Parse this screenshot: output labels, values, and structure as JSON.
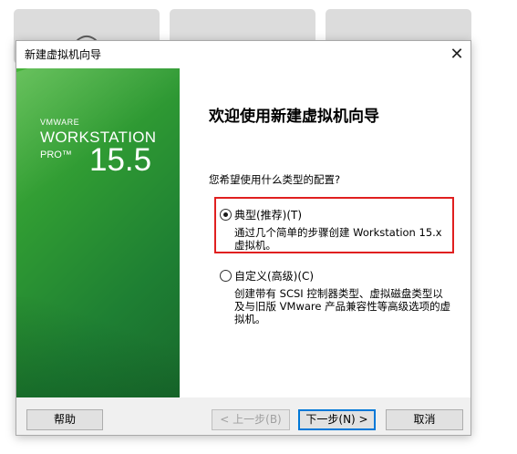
{
  "background_tiles": [
    {
      "icon": "search-circle-icon"
    },
    {
      "icon": "open-external-icon"
    },
    {
      "icon": "arrow-right-icon"
    }
  ],
  "dialog": {
    "title": "新建虚拟机向导",
    "close_glyph": "✕"
  },
  "banner": {
    "brand": "VMWARE",
    "product": "WORKSTATION",
    "edition": "PRO™",
    "version": "15.5",
    "colors": {
      "light": "#47b43a",
      "dark": "#18692c"
    }
  },
  "main": {
    "heading": "欢迎使用新建虚拟机向导",
    "question": "您希望使用什么类型的配置?",
    "options": [
      {
        "label": "典型(推荐)(T)",
        "description": "通过几个简单的步骤创建 Workstation 15.x 虚拟机。",
        "selected": true
      },
      {
        "label": "自定义(高级)(C)",
        "description": "创建带有 SCSI 控制器类型、虚拟磁盘类型以及与旧版 VMware 产品兼容性等高级选项的虚拟机。",
        "selected": false
      }
    ]
  },
  "buttons": {
    "help": "帮助",
    "back": "< 上一步(B)",
    "next": "下一步(N) >",
    "cancel": "取消"
  },
  "colors": {
    "highlight_border": "#e02020",
    "focus_border": "#0078d7"
  }
}
